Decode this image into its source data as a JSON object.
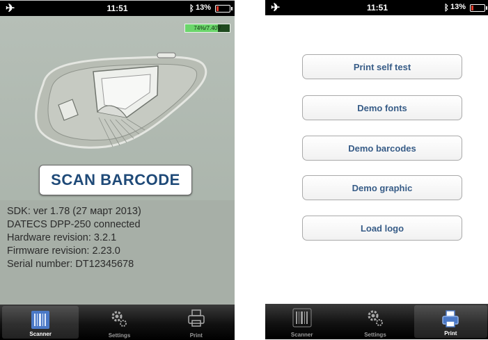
{
  "scanner_phone": {
    "status": {
      "airplane_icon": "airplane-icon",
      "time": "11:51",
      "battery_text": "13%",
      "bluetooth_icon": "bluetooth-icon"
    },
    "printer_battery": {
      "text": "74%/7.40V",
      "level": 0.74,
      "color": "#6bd66b"
    },
    "scan_button_label": "SCAN BARCODE",
    "info": {
      "sdk": "SDK: ver 1.78 (27 март 2013)",
      "device": "DATECS DPP-250  connected",
      "hardware": "Hardware revision: 3.2.1",
      "firmware": "Firmware revision: 2.23.0",
      "serial": "Serial number: DT12345678"
    },
    "tabs": [
      {
        "label": "Scanner",
        "icon": "barcode-icon",
        "active": true
      },
      {
        "label": "Settings",
        "icon": "gears-icon",
        "active": false
      },
      {
        "label": "Print",
        "icon": "printer-icon",
        "active": false
      }
    ]
  },
  "print_phone": {
    "status": {
      "airplane_icon": "airplane-icon",
      "time": "11:51",
      "battery_text": "13%",
      "bluetooth_icon": "bluetooth-icon"
    },
    "buttons": [
      {
        "label": "Print self test"
      },
      {
        "label": "Demo fonts"
      },
      {
        "label": "Demo barcodes"
      },
      {
        "label": "Demo graphic"
      },
      {
        "label": "Load logo"
      }
    ],
    "tabs": [
      {
        "label": "Scanner",
        "icon": "barcode-icon",
        "active": false
      },
      {
        "label": "Settings",
        "icon": "gears-icon",
        "active": false
      },
      {
        "label": "Print",
        "icon": "printer-icon",
        "active": true
      }
    ]
  },
  "colors": {
    "battery_low": "#e23b2a",
    "accent_text": "#1f4a78",
    "button_text": "#375c87"
  }
}
